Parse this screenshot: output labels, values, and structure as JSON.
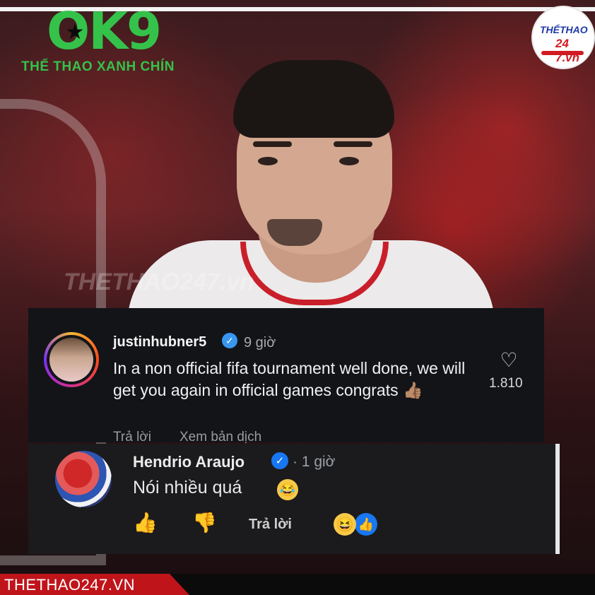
{
  "brand": {
    "logo_main": "OK9",
    "logo_sub": "THỂ THAO XANH CHÍN",
    "badge_line1": "THỂTHAO",
    "badge_line2": "24 7.vn",
    "footer": "THETHAO247.VN",
    "watermark": "THETHAO247.vn"
  },
  "comment1": {
    "username": "justinhubner5",
    "time": "9 giờ",
    "text": "In a non official fifa tournament well done, we will get you again in official games congrats 👍🏽",
    "reply": "Trả lời",
    "translate": "Xem bản dịch",
    "likes": "1.810",
    "icons": [
      "avatar",
      "verified-icon",
      "heart-icon"
    ]
  },
  "comment2": {
    "username": "Hendrio Araujo",
    "time": "· 1 giờ",
    "text": "Nói nhiều quá",
    "reply": "Trả lời",
    "icons": [
      "avatar",
      "verified-icon",
      "laugh-emoji-icon",
      "like-icon",
      "dislike-icon",
      "laugh-reaction-icon",
      "like-reaction-icon"
    ]
  },
  "colors": {
    "brand_green": "#34c24a",
    "fb_blue": "#1877f2",
    "ig_blue": "#3897f0",
    "accent_red": "#c0141b"
  }
}
